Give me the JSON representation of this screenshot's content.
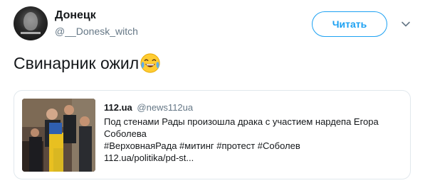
{
  "author": {
    "name": "Донецк",
    "handle": "@__Donesk_witch"
  },
  "follow_button": {
    "label": "Читать"
  },
  "tweet": {
    "text": "Свинарник ожил",
    "emoji_icon": "face-with-tears-of-joy-icon"
  },
  "card": {
    "source_name": "112.ua",
    "source_handle": "@news112ua",
    "text_line1": "Под стенами Рады произошла драка с участием нардепа Егора",
    "text_line2": "Соболева",
    "hashtags": "#ВерховнаяРада #митинг #протест #Соболев",
    "link": "112.ua/politika/pd-st..."
  },
  "colors": {
    "accent": "#1da1f2",
    "muted_text": "#657786",
    "text": "#14171a",
    "border": "#e1e8ed"
  }
}
